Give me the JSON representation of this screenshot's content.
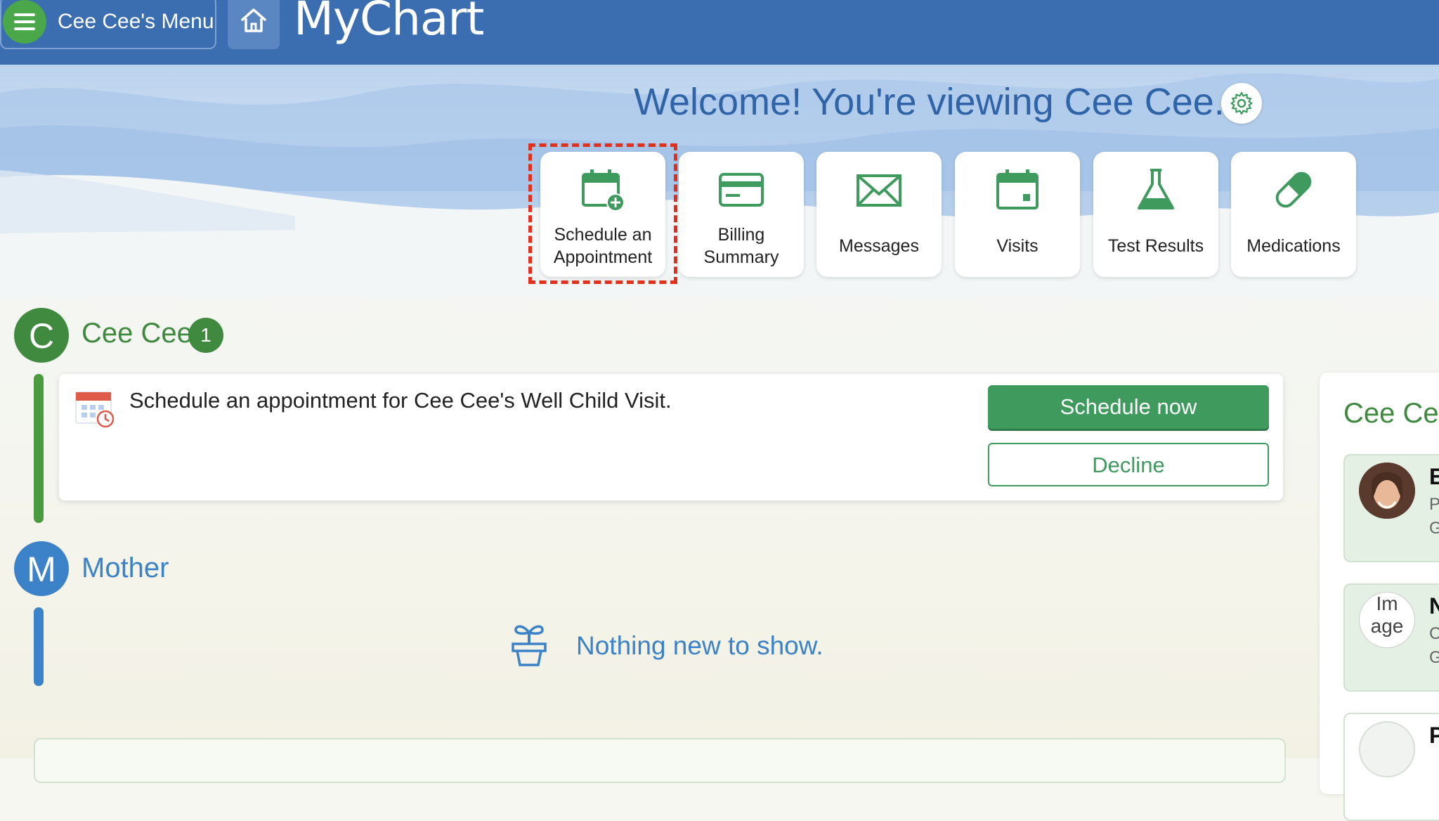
{
  "header": {
    "menu_label": "Cee Cee's Menu",
    "brand": "MyChart"
  },
  "welcome": {
    "text": "Welcome! You're viewing Cee Cee."
  },
  "quick_actions": [
    {
      "line1": "Schedule an",
      "line2": "Appointment",
      "icon": "calendar-plus-icon",
      "highlighted": true
    },
    {
      "line1": "Billing",
      "line2": "Summary",
      "icon": "credit-card-icon"
    },
    {
      "label": "Messages",
      "icon": "envelope-icon"
    },
    {
      "label": "Visits",
      "icon": "calendar-icon"
    },
    {
      "label": "Test Results",
      "icon": "flask-icon"
    },
    {
      "label": "Medications",
      "icon": "pill-icon"
    }
  ],
  "feed": {
    "patient": {
      "initial": "C",
      "name": "Cee Cee",
      "badge_count": "1",
      "color": "#3f8a3f"
    },
    "card": {
      "text": "Schedule an appointment for Cee Cee's Well Child Visit.",
      "primary_button": "Schedule now",
      "secondary_button": "Decline"
    },
    "mother": {
      "initial": "M",
      "name": "Mother",
      "color": "#3b82c9"
    },
    "empty_text": "Nothing new to show."
  },
  "side_panel": {
    "title": "Cee Cee",
    "providers": [
      {
        "name": "E",
        "line1": "P",
        "line2": "G"
      },
      {
        "name": "N",
        "line1": "C",
        "line2": "G",
        "alt_line1": "Im",
        "alt_line2": "age"
      },
      {
        "name": "P"
      }
    ]
  },
  "colors": {
    "header_blue": "#3b6db1",
    "accent_green": "#3f9a5e",
    "highlight_red": "#e0301e"
  }
}
